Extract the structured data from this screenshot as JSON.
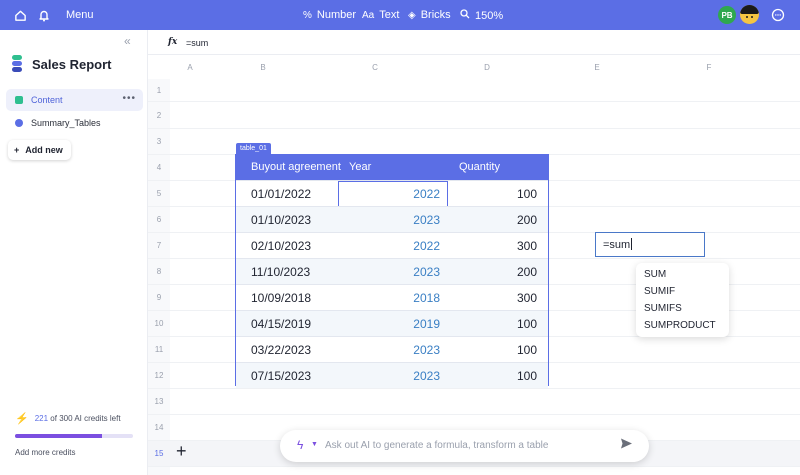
{
  "topbar": {
    "menu_label": "Menu",
    "home_icon": "home-icon",
    "bell_icon": "bell-icon",
    "number_label": "Number",
    "text_label": "Text",
    "bricks_label": "Bricks",
    "zoom_label": "150%",
    "user_initials": "PB",
    "chat_icon": "chat-icon",
    "accent": "#5b6ee5"
  },
  "sidebar": {
    "title": "Sales Report",
    "items": [
      {
        "label": "Content",
        "active": true,
        "color": "#2fbf8f"
      },
      {
        "label": "Summary_Tables",
        "active": false,
        "color": "#5b6ee5"
      }
    ],
    "add_new": "Add new",
    "credits_used": "221",
    "credits_text": "of 300 AI credits left",
    "credits_fraction": 0.74,
    "add_credits": "Add more credits"
  },
  "formula_bar": {
    "fx": "fx",
    "value": "=sum"
  },
  "grid": {
    "columns": [
      "A",
      "B",
      "C",
      "D",
      "E",
      "F"
    ],
    "rows": [
      "1",
      "2",
      "3",
      "4",
      "5",
      "6",
      "7",
      "8",
      "9",
      "10",
      "11",
      "12",
      "13",
      "14",
      "15"
    ],
    "selected_row": "15"
  },
  "table": {
    "name": "table_01",
    "headers": [
      "Buyout agreement",
      "Year",
      "Quantity"
    ],
    "rows": [
      {
        "date": "01/01/2022",
        "year": "2022",
        "qty": "100"
      },
      {
        "date": "01/10/2023",
        "year": "2023",
        "qty": "200"
      },
      {
        "date": "02/10/2023",
        "year": "2022",
        "qty": "300"
      },
      {
        "date": "11/10/2023",
        "year": "2023",
        "qty": "200"
      },
      {
        "date": "10/09/2018",
        "year": "2018",
        "qty": "300"
      },
      {
        "date": "04/15/2019",
        "year": "2019",
        "qty": "100"
      },
      {
        "date": "03/22/2023",
        "year": "2023",
        "qty": "100"
      },
      {
        "date": "07/15/2023",
        "year": "2023",
        "qty": "100"
      }
    ]
  },
  "formula_cell": {
    "value": "=sum",
    "suggestions": [
      "SUM",
      "SUMIF",
      "SUMIFS",
      "SUMPRODUCT"
    ]
  },
  "ai_bar": {
    "placeholder": "Ask out AI to generate a formula, transform a table",
    "spark_icon": "sparkle-icon",
    "send_icon": "send-icon"
  }
}
